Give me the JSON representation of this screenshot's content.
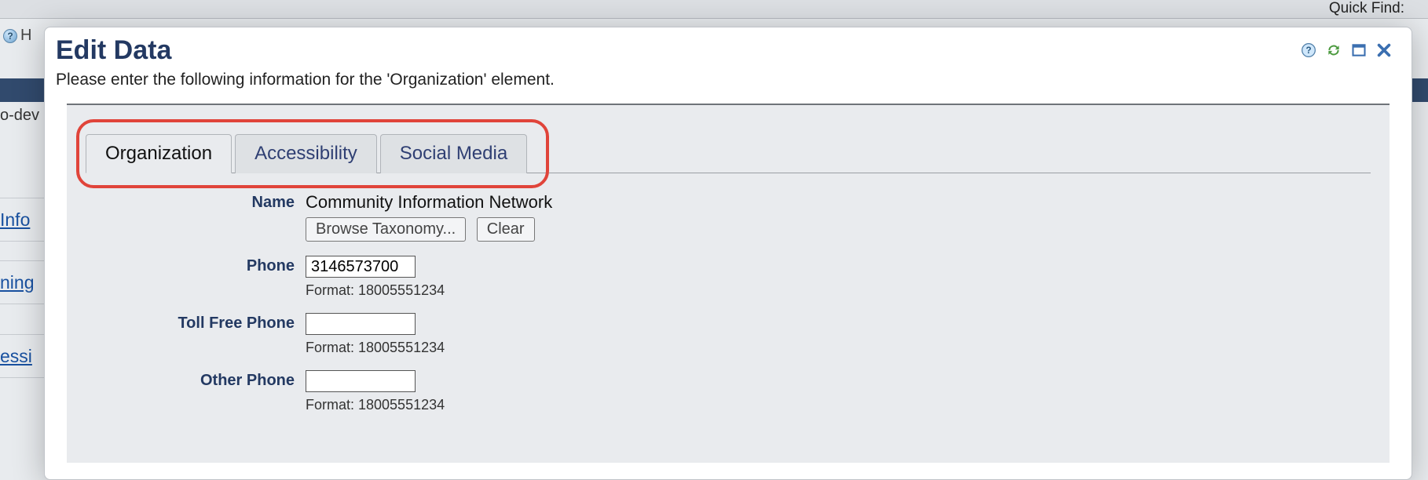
{
  "background": {
    "quick_find_label": "Quick Find:",
    "help_letter": "H",
    "dev_fragment": "o-dev",
    "links": [
      "Info",
      "ning",
      "essi"
    ]
  },
  "modal": {
    "title": "Edit Data",
    "subtitle": "Please enter the following information for the 'Organization' element.",
    "toolbar_icons": {
      "help": "help-icon",
      "refresh": "refresh-icon",
      "maximize": "maximize-icon",
      "close": "close-icon"
    }
  },
  "tabs": [
    {
      "label": "Organization",
      "active": true
    },
    {
      "label": "Accessibility",
      "active": false
    },
    {
      "label": "Social Media",
      "active": false
    }
  ],
  "form": {
    "name": {
      "label": "Name",
      "value": "Community Information Network",
      "browse_btn": "Browse Taxonomy...",
      "clear_btn": "Clear"
    },
    "phone": {
      "label": "Phone",
      "value": "3146573700",
      "hint": "Format: 18005551234"
    },
    "toll_free": {
      "label": "Toll Free Phone",
      "value": "",
      "hint": "Format: 18005551234"
    },
    "other_phone": {
      "label": "Other Phone",
      "value": "",
      "hint": "Format: 18005551234"
    }
  }
}
